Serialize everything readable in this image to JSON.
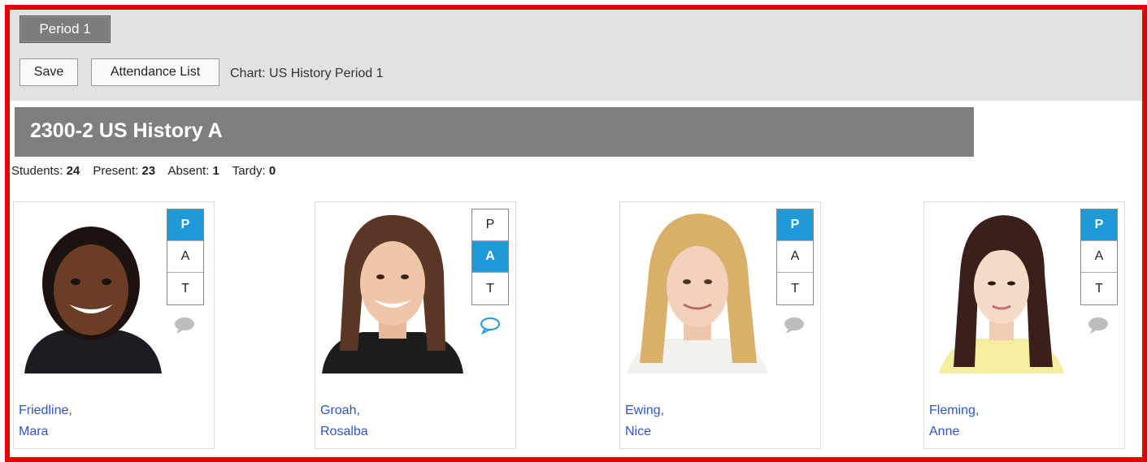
{
  "tabs": [
    {
      "label": "Period 1"
    }
  ],
  "toolbar": {
    "save_label": "Save",
    "attendance_label": "Attendance List",
    "chart_label": "Chart: US History Period 1"
  },
  "course": {
    "title": "2300-2 US History A"
  },
  "stats": {
    "students_label": "Students:",
    "students": "24",
    "present_label": "Present:",
    "present": "23",
    "absent_label": "Absent:",
    "absent": "1",
    "tardy_label": "Tardy:",
    "tardy": "0"
  },
  "attendance_codes": [
    "P",
    "A",
    "T"
  ],
  "students": [
    {
      "last": "Friedline,",
      "first": "Mara",
      "status": "P",
      "comment_active": false
    },
    {
      "last": "Groah,",
      "first": "Rosalba",
      "status": "A",
      "comment_active": true
    },
    {
      "last": "Ewing,",
      "first": "Nice",
      "status": "P",
      "comment_active": false
    },
    {
      "last": "Fleming,",
      "first": "Anne",
      "status": "P",
      "comment_active": false
    }
  ],
  "colors": {
    "frame": "#e50000",
    "selected": "#1f9ad6",
    "link": "#2f55c8",
    "header_bar": "#7f7f7f"
  },
  "icons": {
    "comment": "comment-bubble-icon",
    "photo": "student-photo"
  }
}
